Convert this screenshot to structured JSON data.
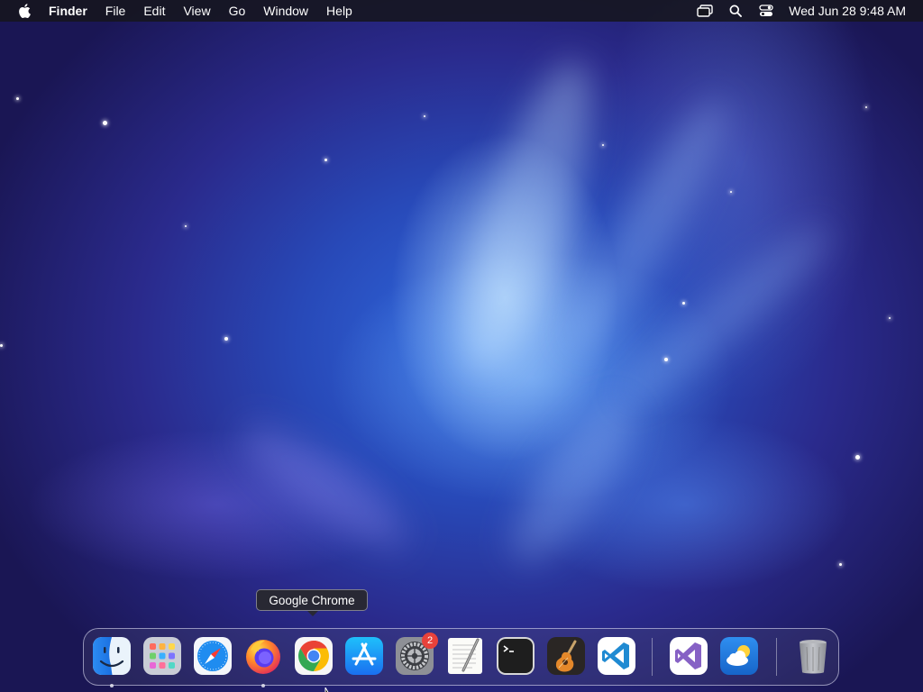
{
  "menubar": {
    "apple_icon": "apple-logo-icon",
    "app_name": "Finder",
    "menus": [
      "File",
      "Edit",
      "View",
      "Go",
      "Window",
      "Help"
    ],
    "status_icons": [
      "screen-mirroring-icon",
      "spotlight-search-icon",
      "control-center-icon"
    ],
    "clock": "Wed Jun 28  9:48 AM"
  },
  "tooltip": {
    "text": "Google Chrome"
  },
  "dock": {
    "apps": [
      {
        "name": "Finder",
        "icon": "finder-icon",
        "running": true
      },
      {
        "name": "Launchpad",
        "icon": "launchpad-icon",
        "running": false
      },
      {
        "name": "Safari",
        "icon": "safari-icon",
        "running": false
      },
      {
        "name": "Firefox",
        "icon": "firefox-icon",
        "running": true
      },
      {
        "name": "Google Chrome",
        "icon": "chrome-icon",
        "running": false
      },
      {
        "name": "App Store",
        "icon": "app-store-icon",
        "running": false
      },
      {
        "name": "System Settings",
        "icon": "system-settings-icon",
        "running": false,
        "badge": "2"
      },
      {
        "name": "TextEdit",
        "icon": "textedit-icon",
        "running": false
      },
      {
        "name": "Terminal",
        "icon": "terminal-icon",
        "running": false
      },
      {
        "name": "GarageBand",
        "icon": "garageband-icon",
        "running": false
      },
      {
        "name": "Visual Studio Code",
        "icon": "vscode-icon",
        "running": false
      }
    ],
    "recent_apps": [
      {
        "name": "Visual Studio",
        "icon": "visual-studio-icon",
        "running": false
      },
      {
        "name": "Weather",
        "icon": "weather-icon",
        "running": false
      }
    ],
    "trash": {
      "name": "Trash",
      "icon": "trash-icon"
    }
  },
  "colors": {
    "menubar_bg": "#16161e",
    "badge": "#e8423b",
    "wallpaper_core": "#2f6ae0",
    "wallpaper_edge": "#1a1654"
  }
}
